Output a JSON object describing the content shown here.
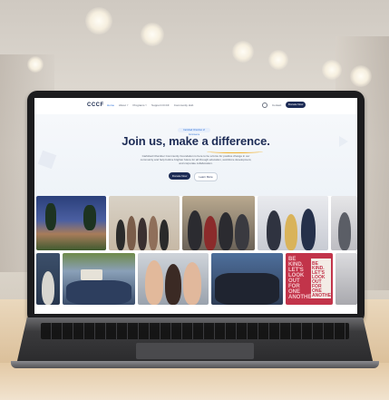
{
  "site": {
    "logo": "CCCF",
    "nav": [
      "Home",
      "About ˅",
      "Programs ˅",
      "Support CCCF",
      "Community Hub"
    ],
    "contact": "Contact",
    "donate": "Donate Now",
    "pill": "Carlsbad Chamber of Commerce",
    "headline": "Join us, make a difference.",
    "description": "Carlsbad Chamber Community Foundation is here to be a force for positive change in our community and help build a brighter future for all through education, workforce development, and corporate collaboration.",
    "cta_primary": "Donate Now",
    "cta_secondary": "Learn More"
  },
  "sign": {
    "left_text": "BE KIND. LET'S LOOK OUT FOR ONE ANOTHER.",
    "right_text": "BE KIND. LET'S LOOK OUT FOR ONE ANOTHER."
  },
  "colors": {
    "navy": "#1c2b55",
    "accent": "#2a6fd6",
    "underline": "#f2b230",
    "sign": "#c2344a"
  }
}
